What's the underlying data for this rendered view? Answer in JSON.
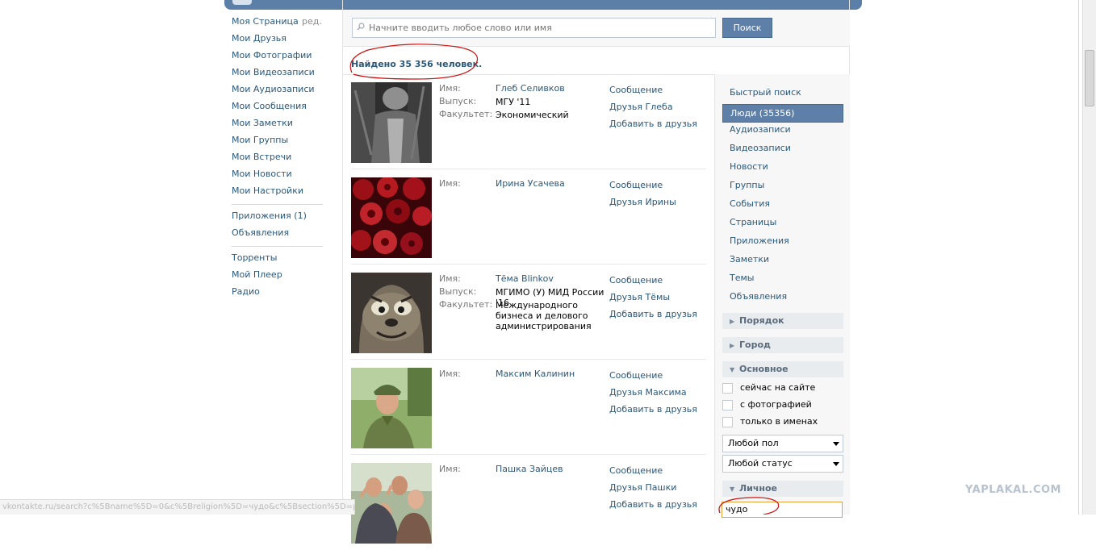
{
  "left_nav": {
    "items": [
      {
        "label": "Моя Страница",
        "edit": "ред."
      },
      {
        "label": "Мои Друзья"
      },
      {
        "label": "Мои Фотографии"
      },
      {
        "label": "Мои Видеозаписи"
      },
      {
        "label": "Мои Аудиозаписи"
      },
      {
        "label": "Мои Сообщения"
      },
      {
        "label": "Мои Заметки"
      },
      {
        "label": "Мои Группы"
      },
      {
        "label": "Мои Встречи"
      },
      {
        "label": "Мои Новости"
      },
      {
        "label": "Мои Настройки"
      }
    ],
    "apps_label": "Приложения (1)",
    "ads_label": "Объявления",
    "extra": [
      "Торренты",
      "Мой Плеер",
      "Радио"
    ]
  },
  "search": {
    "placeholder": "Начните вводить любое слово или имя",
    "button_label": "Поиск"
  },
  "found_text": "Найдено 35 356 человек.",
  "results": [
    {
      "fields": [
        {
          "k": "Имя:",
          "v": "Глеб Селивков"
        },
        {
          "k": "Выпуск:",
          "v": "МГУ '11"
        },
        {
          "k": "Факультет:",
          "v": "Экономический"
        }
      ],
      "actions": [
        "Сообщение",
        "Друзья Глеба",
        "Добавить в друзья"
      ]
    },
    {
      "fields": [
        {
          "k": "Имя:",
          "v": "Ирина Усачева"
        }
      ],
      "actions": [
        "Сообщение",
        "Друзья Ирины"
      ]
    },
    {
      "fields": [
        {
          "k": "Имя:",
          "v": "Тёма Blinkov"
        },
        {
          "k": "Выпуск:",
          "v": "МГИМО (У) МИД России '16"
        },
        {
          "k": "Факультет:",
          "v": "Международного бизнеса и делового администрирования"
        }
      ],
      "actions": [
        "Сообщение",
        "Друзья Тёмы",
        "Добавить в друзья"
      ]
    },
    {
      "fields": [
        {
          "k": "Имя:",
          "v": "Максим Калинин"
        }
      ],
      "actions": [
        "Сообщение",
        "Друзья Максима",
        "Добавить в друзья"
      ]
    },
    {
      "fields": [
        {
          "k": "Имя:",
          "v": "Пашка Зайцев"
        }
      ],
      "actions": [
        "Сообщение",
        "Друзья Пашки",
        "Добавить в друзья"
      ]
    }
  ],
  "filter": {
    "tabs": [
      "Быстрый поиск",
      "Люди (35356)",
      "Аудиозаписи",
      "Видеозаписи",
      "Новости",
      "Группы",
      "События",
      "Страницы",
      "Приложения",
      "Заметки",
      "Темы",
      "Объявления"
    ],
    "active_tab": "Люди (35356)",
    "sections": {
      "order": "Порядок",
      "city": "Город",
      "basic": "Основное",
      "personal": "Личное"
    },
    "checkboxes": [
      "сейчас на сайте",
      "с фотографией",
      "только в именах"
    ],
    "gender_select": "Любой пол",
    "status_select": "Любой статус",
    "personal_input_value": "чудо"
  },
  "status_url": "vkontakte.ru/search?c%5Bname%5D=0&c%5Breligion%5D=чудо&c%5Bsection%5D=people",
  "watermark": "YAPLAKAL.COM",
  "colors": {
    "link": "#2b587a",
    "accent": "#5e80a8",
    "annotation": "#cc1111"
  }
}
